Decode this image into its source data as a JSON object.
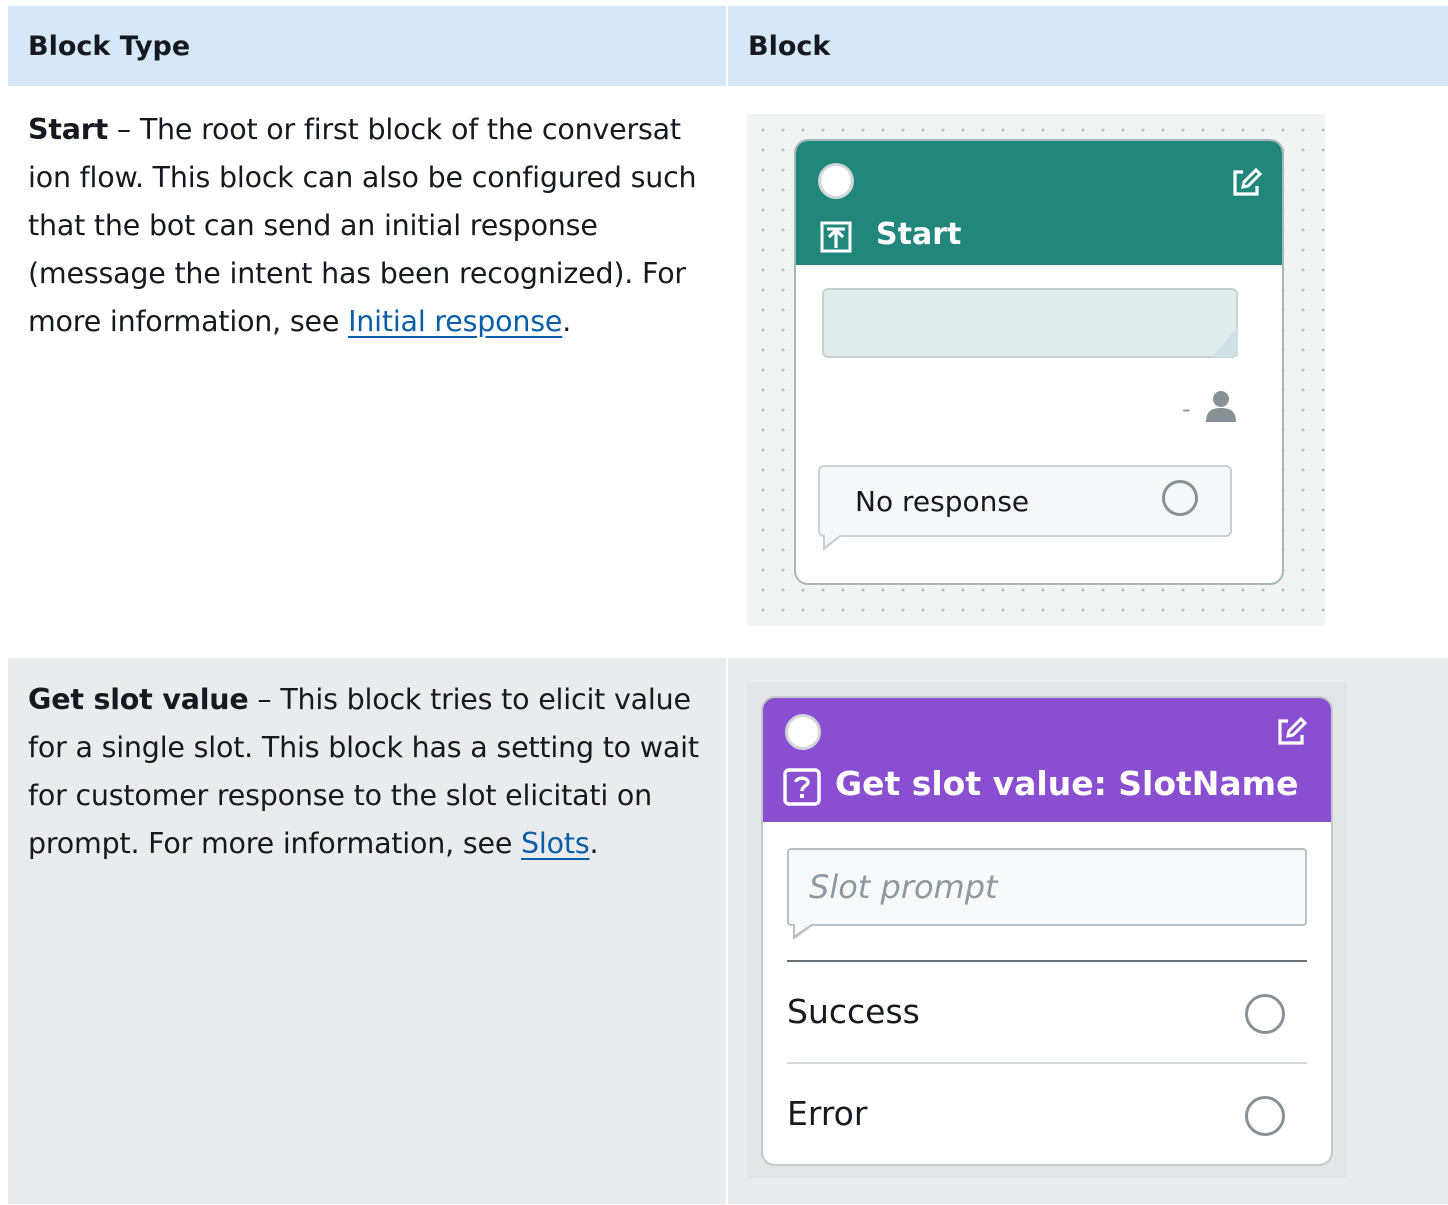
{
  "table": {
    "headers": [
      "Block Type",
      "Block"
    ],
    "rows": [
      {
        "name": "Start",
        "separator": "–",
        "description": "The root or first block of the conversat ion flow. This block can also be configured such that the bot can send an initial response (message the intent has been recognized). For more information, see",
        "link_text": "Initial response",
        "trailing": "."
      },
      {
        "name": "Get slot value",
        "separator": "–",
        "description": "This block tries to elicit value for a single slot. This block has a setting to wait for customer response to the slot elicitati on prompt. For more information, see",
        "link_text": "Slots",
        "trailing": "."
      }
    ]
  },
  "start_block": {
    "title": "Start",
    "user_dash": "-",
    "no_response_label": "No response",
    "header_color": "#21877a"
  },
  "slot_block": {
    "title": "Get slot value: SlotName",
    "prompt_placeholder": "Slot prompt",
    "outputs": [
      "Success",
      "Error"
    ],
    "header_color": "#8a4fd0"
  },
  "colors": {
    "header_bg": "#d6e8f7",
    "row2_bg": "#e9ebed",
    "link": "#0a5ea8"
  }
}
